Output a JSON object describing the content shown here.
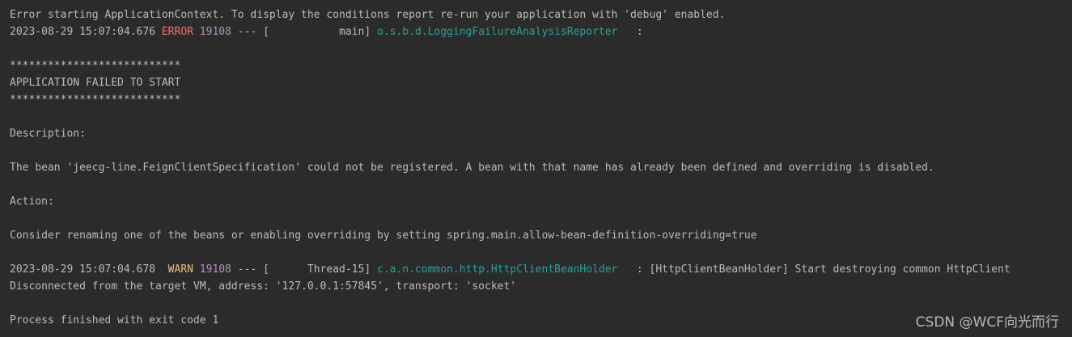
{
  "console": {
    "line1": "Error starting ApplicationContext. To display the conditions report re-run your application with 'debug' enabled.",
    "log1": {
      "timestamp": "2023-08-29 15:07:04.676 ",
      "level": "ERROR",
      "pid": " 19108",
      "mid": " --- [           main] ",
      "logger": "o.s.b.d.LoggingFailureAnalysisReporter",
      "rest": "   : "
    },
    "stars_top": "***************************",
    "app_failed": "APPLICATION FAILED TO START",
    "stars_bottom": "***************************",
    "description_label": "Description:",
    "description_text": "The bean 'jeecg-line.FeignClientSpecification' could not be registered. A bean with that name has already been defined and overriding is disabled.",
    "action_label": "Action:",
    "action_text": "Consider renaming one of the beans or enabling overriding by setting spring.main.allow-bean-definition-overriding=true",
    "log2": {
      "timestamp": "2023-08-29 15:07:04.678  ",
      "level": "WARN",
      "pid": " 19108",
      "mid": " --- [      Thread-15] ",
      "logger": "c.a.n.common.http.HttpClientBeanHolder",
      "rest": "   : [HttpClientBeanHolder] Start destroying common HttpClient"
    },
    "disconnected": "Disconnected from the target VM, address: '127.0.0.1:57845', transport: 'socket'",
    "process_finished": "Process finished with exit code 1"
  },
  "watermark": "CSDN @WCF向光而行"
}
